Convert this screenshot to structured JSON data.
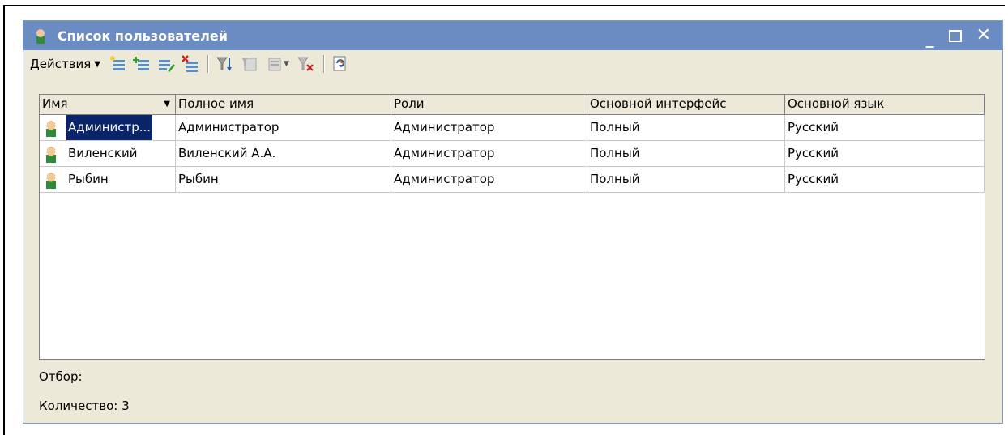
{
  "window": {
    "title": "Список пользователей",
    "controls": {
      "minimize": "_",
      "close": "✕"
    }
  },
  "toolbar": {
    "actions_label": "Действия",
    "icons": [
      "add-icon",
      "add-copy-icon",
      "edit-icon",
      "delete-icon",
      "filter-icon",
      "filter-value-icon",
      "filter-list-icon",
      "clear-filter-icon",
      "refresh-icon"
    ]
  },
  "table": {
    "columns": [
      "Имя",
      "Полное имя",
      "Роли",
      "Основной интерфейс",
      "Основной язык"
    ],
    "rows": [
      {
        "name": "Администр...",
        "full_name": "Администратор",
        "roles": "Администратор",
        "interface": "Полный",
        "language": "Русский",
        "selected": true
      },
      {
        "name": "Виленский",
        "full_name": "Виленский А.А.",
        "roles": "Администратор",
        "interface": "Полный",
        "language": "Русский"
      },
      {
        "name": "Рыбин",
        "full_name": "Рыбин",
        "roles": "Администратор",
        "interface": "Полный",
        "language": "Русский"
      }
    ]
  },
  "footer": {
    "filter_label": "Отбор:",
    "count_label": "Количество: 3"
  },
  "colors": {
    "titlebar": "#6b8cc3",
    "window_bg": "#ece9d8",
    "selection": "#0a246a"
  }
}
